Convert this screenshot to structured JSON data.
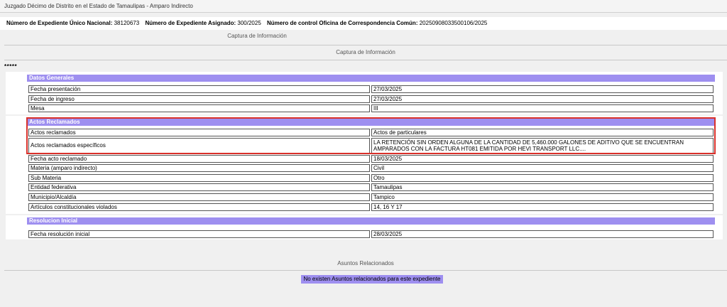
{
  "window": {
    "title": "Juzgado Décimo de Distrito en el Estado de Tamaulipas - Amparo Indirecto"
  },
  "expediente": {
    "unico_label": "Número de Expediente Único Nacional:",
    "unico_value": "38120673",
    "asignado_label": "Número de Expediente Asignado:",
    "asignado_value": "300/2025",
    "control_label": "Número de control Oficina de Correspondencia Común:",
    "control_value": "20250908033500106/2025"
  },
  "captura_small": "Captura de Información",
  "captura_header": "Captura de Información",
  "stars": "*****",
  "datos_generales": {
    "title": "Datos Generales",
    "rows": [
      {
        "label": "Fecha presentación",
        "value": "27/03/2025"
      },
      {
        "label": "Fecha de ingreso",
        "value": "27/03/2025"
      },
      {
        "label": "Mesa",
        "value": "III"
      }
    ]
  },
  "actos_reclamados": {
    "title": "Actos Reclamados",
    "rows": [
      {
        "label": "Actos reclamados",
        "value": "Actos de particulares"
      },
      {
        "label": "Actos reclamados específicos",
        "value": "LA RETENCIÓN SIN ORDEN ALGUNA DE LA CANTIDAD DE 5,460.000 GALONES DE ADITIVO QUE SE ENCUENTRAN AMPARADOS CON LA FACTURA HT081 EMITIDA POR HEVI TRANSPORT LLC...."
      },
      {
        "label": "Fecha acto reclamado",
        "value": "18/03/2025"
      },
      {
        "label": "Materia (amparo indirecto)",
        "value": "Civil"
      },
      {
        "label": "Sub Materia",
        "value": "Otro"
      },
      {
        "label": "Entidad federativa",
        "value": "Tamaulipas"
      },
      {
        "label": "Municipio/Alcaldía",
        "value": "Tampico"
      },
      {
        "label": "Artículos constitucionales violados",
        "value": "14, 16 Y 17"
      }
    ]
  },
  "resolucion_inicial": {
    "title": "Resolucion Inicial",
    "rows": [
      {
        "label": "Fecha resolución inicial",
        "value": "28/03/2025"
      }
    ]
  },
  "asuntos": {
    "title": "Asuntos Relacionados",
    "empty_message": "No existen Asuntos relacionados para este expediente"
  },
  "colors": {
    "section_header": "#9e8ff0",
    "highlight_border": "#d9302a"
  }
}
